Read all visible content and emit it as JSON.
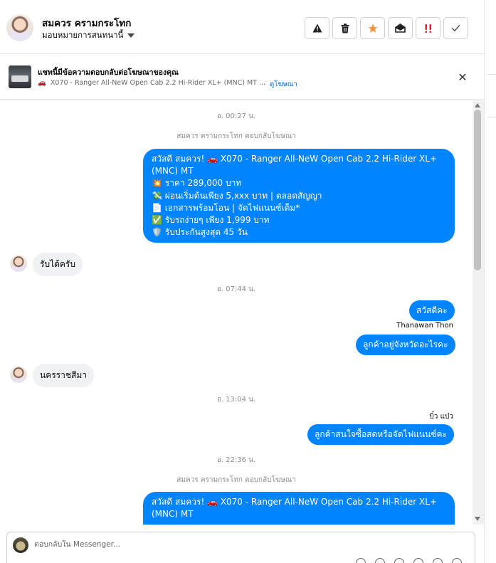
{
  "header": {
    "name": "สมควร ครามกระโทก",
    "assign_label": "มอบหมายการสนทนานี้",
    "actions": [
      {
        "icon": "warning-icon",
        "label": "Report"
      },
      {
        "icon": "trash-icon",
        "label": "Delete"
      },
      {
        "icon": "star-icon",
        "label": "Star"
      },
      {
        "icon": "envelope-open-icon",
        "label": "Mark unread"
      },
      {
        "icon": "priority-icon",
        "label": "Spam"
      },
      {
        "icon": "check-icon",
        "label": "Done"
      }
    ],
    "colors": {
      "star": "#f7923a",
      "priority": "#e41e3f"
    }
  },
  "ad": {
    "title": "แชทนี้มีข้อความตอบกลับต่อโฆษณาของคุณ",
    "car_emoji": "🚗",
    "ad_name": "X070 - Ranger All-NeW Open Cab 2.2 Hi-Rider XL+ (MNC) MT ...",
    "view_ad": "ดูโฆษณา"
  },
  "chat": {
    "ts1": "อ. 00:27 น.",
    "sys1": "สมควร ครามกระโทก ตอบกลับโฆษณา",
    "ad_msg1": [
      "สวัสดี สมควร! 🚗 X070 - Ranger All-NeW Open Cab 2.2 Hi-Rider XL+",
      "(MNC) MT",
      "💥 ราคา 289,000 บาท",
      "💸 ผ่อนเริ่มต้นเพียง 5,xxx บาท | ตลอดสัญญา",
      "📄 เอกสารพร้อมโอน | จัดไฟแนนซ์เต็ม*",
      "✅ รับรถง่ายๆ เพียง 1,999 บาท",
      "🛡️ รับประกันสูงสุด 45 วัน"
    ],
    "in1": "รับได้ครับ",
    "ts2": "อ. 07:44 น.",
    "out1": "สวัสดีคะ",
    "sender1": "Thanawan Thon",
    "out2": "ลูกค้าอยู่จังหวัดอะไรคะ",
    "in2": "นครราชสีมา",
    "ts3": "อ. 13:04 น.",
    "sender2": "บิ๋ว แบ๋ว",
    "out3": "ลูกค้าสนใจซื้อสดหรือจัดไฟแนนซ์คะ",
    "ts4": "อ. 22:36 น.",
    "sys2": "สมควร ครามกระโทก ตอบกลับโฆษณา",
    "ad_msg2": [
      "สวัสดี สมควร! 🚗 X070 - Ranger All-NeW Open Cab 2.2 Hi-Rider XL+",
      "(MNC) MT"
    ],
    "colors": {
      "outgoing": "#0084ff",
      "incoming": "#eff1f4"
    }
  },
  "composer": {
    "placeholder": "ตอบกลับใน Messenger..."
  }
}
